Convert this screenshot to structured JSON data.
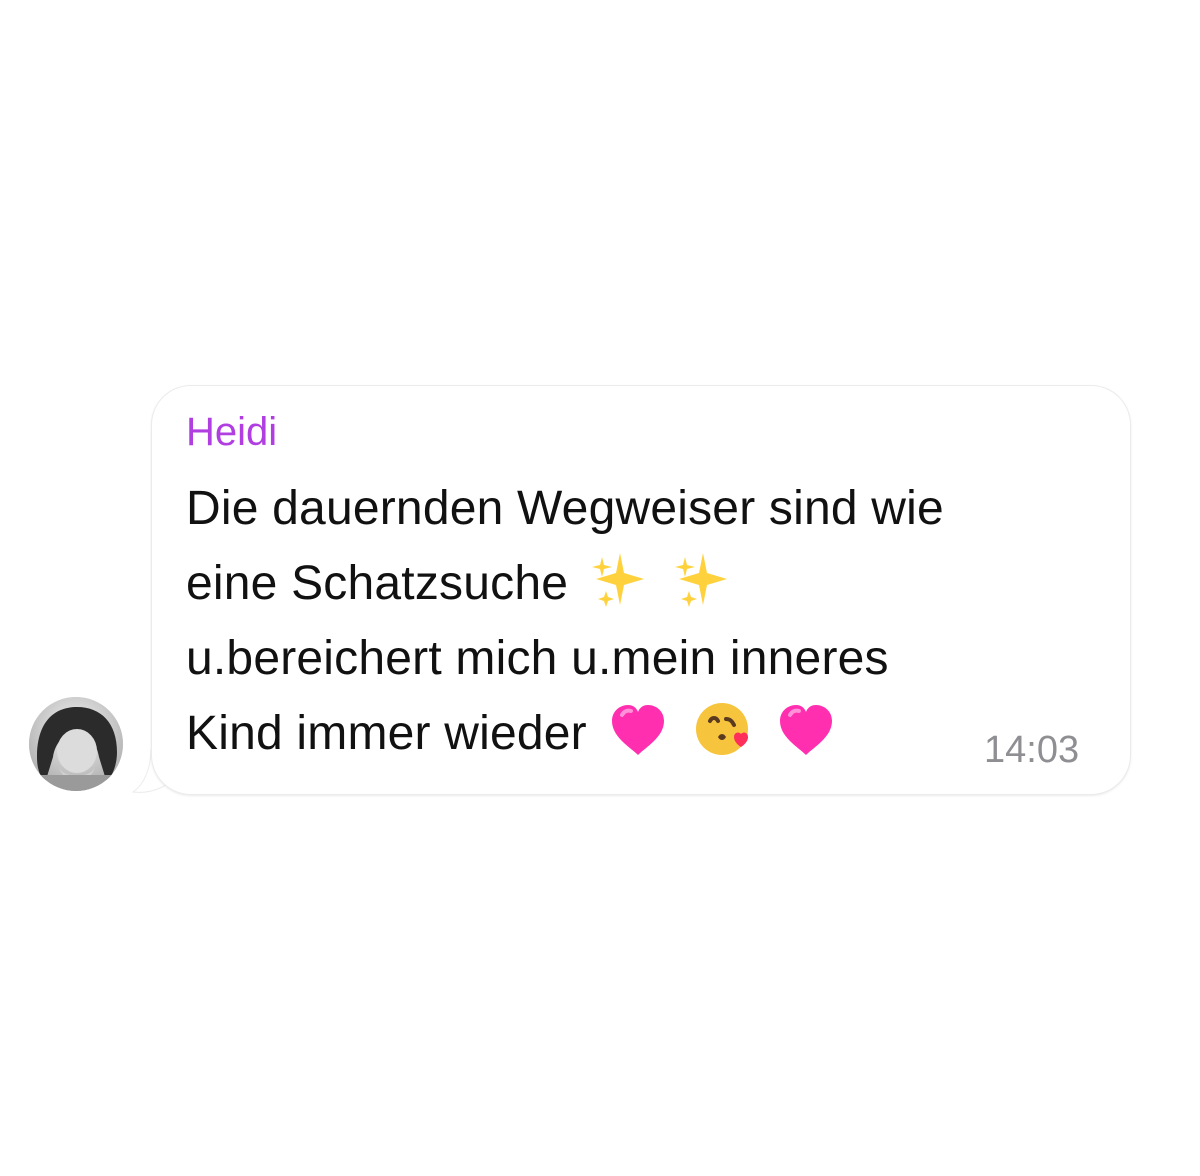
{
  "chat": {
    "message": {
      "sender_name": "Heidi",
      "lines": [
        "Die dauernden Wegweiser sind wie",
        "eine Schatzsuche",
        "u.bereichert mich u.mein inneres",
        "Kind immer wieder"
      ],
      "emojis": {
        "line2": [
          "sparkles-icon",
          "sparkles-icon"
        ],
        "line4": [
          "pink-heart-icon",
          "kissing-face-icon",
          "pink-heart-icon"
        ]
      },
      "time": "14:03"
    },
    "avatar": {
      "icon": "avatar"
    }
  },
  "colors": {
    "sender_name": "#b03ee0",
    "message_text": "#111111",
    "timestamp": "#8e8e93",
    "bubble_border": "#ecebea",
    "heart": "#ff2fb0",
    "sparkles": "#ffd23d"
  }
}
